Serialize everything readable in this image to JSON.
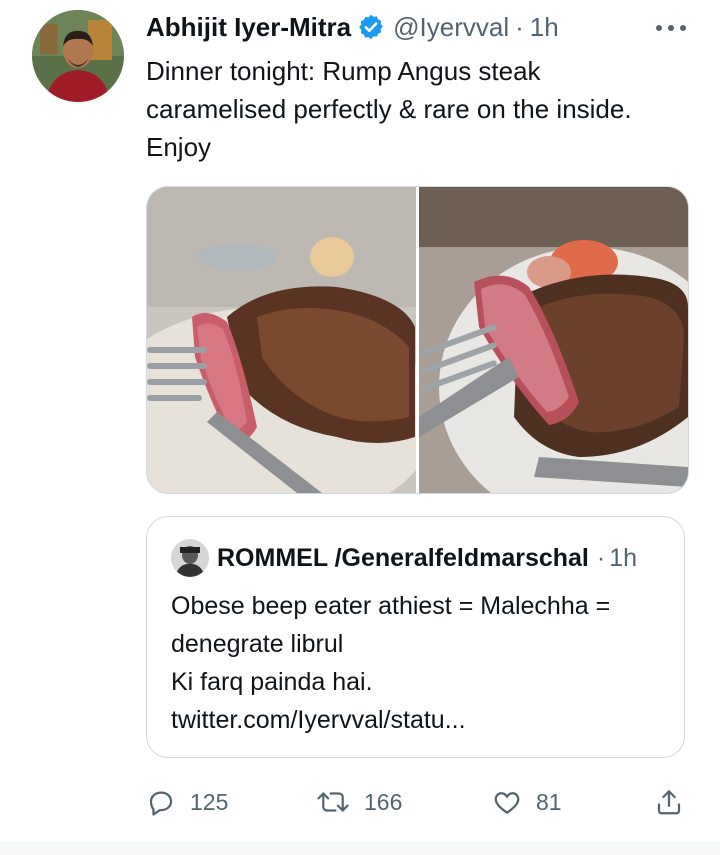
{
  "author": {
    "name": "Abhijit Iyer-Mitra",
    "handle": "@Iyervval",
    "separator": "·",
    "time": "1h",
    "verified": true
  },
  "tweet": {
    "text_lines": [
      "Dinner tonight: Rump Angus steak",
      "caramelised perfectly & rare on the inside.",
      "Enjoy"
    ]
  },
  "media": {
    "photos": [
      "steak-photo-1",
      "steak-photo-2"
    ]
  },
  "quoted_tweet": {
    "name": "ROMMEL /Generalfeldmarschal",
    "separator": "·",
    "time": "1h",
    "text_lines": [
      "Obese beep eater athiest = Malechha =",
      "denegrate librul",
      "Ki farq painda hai.",
      "twitter.com/Iyervval/statu..."
    ]
  },
  "actions": {
    "reply_count": "125",
    "retweet_count": "166",
    "like_count": "81"
  },
  "colors": {
    "accent": "#1d9bf0",
    "text_primary": "#0f1419",
    "text_secondary": "#536471",
    "border": "#cfd9de"
  },
  "icons": [
    "more-icon",
    "verified-icon",
    "reply-icon",
    "retweet-icon",
    "like-icon",
    "share-icon"
  ]
}
